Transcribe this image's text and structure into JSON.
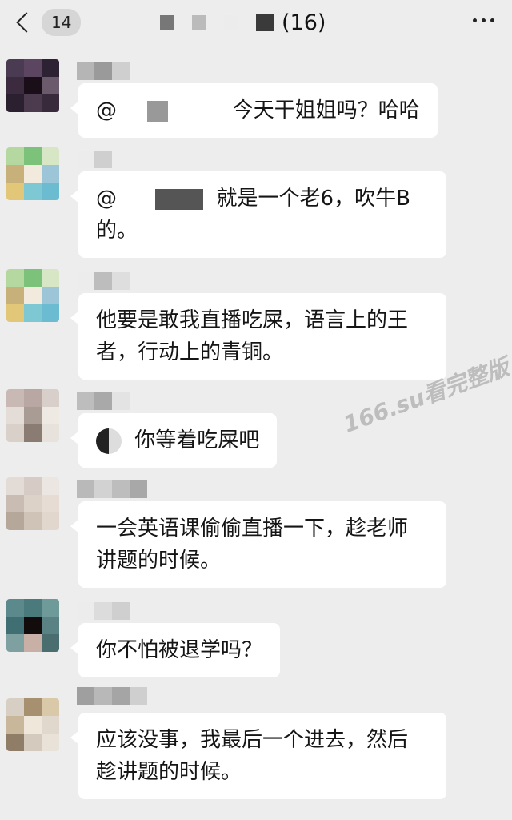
{
  "header": {
    "back_count": "14",
    "title_count": "(16)",
    "icons": {
      "back": "chevron-left-icon",
      "more": "more-dots-icon"
    }
  },
  "messages": [
    {
      "mention": "@",
      "text": "今天干姐姐吗？哈哈"
    },
    {
      "mention": "@",
      "line1": "就是一个老6，吹牛B",
      "line2": "的。"
    },
    {
      "line1": "他要是敢我直播吃屎，语言上的王",
      "line2": "者，行动上的青铜。"
    },
    {
      "text": "你等着吃屎吧"
    },
    {
      "line1": "一会英语课偷偷直播一下，趁老师",
      "line2": "讲题的时候。"
    },
    {
      "text": "你不怕被退学吗？"
    },
    {
      "line1": "应该没事，我最后一个进去，然后",
      "line2": "趁讲题的时候。"
    }
  ],
  "watermark": "166.su看完整版"
}
